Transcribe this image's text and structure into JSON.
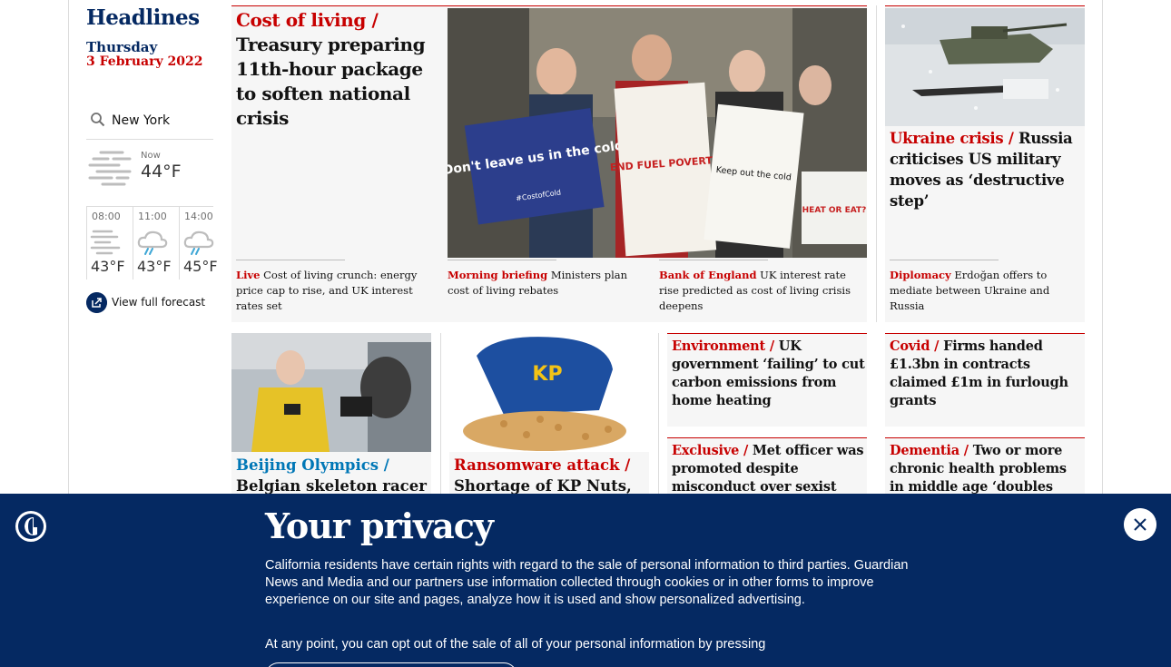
{
  "sidebar": {
    "title": "Headlines",
    "day": "Thursday",
    "date": "3 February 2022",
    "weather": {
      "city": "New York",
      "now_label": "Now",
      "now_temp": "44°F",
      "now_icon": "fog-icon",
      "hours": [
        {
          "time": "08:00",
          "temp": "43°F",
          "icon": "fog-icon"
        },
        {
          "time": "11:00",
          "temp": "43°F",
          "icon": "rain-cloud-icon"
        },
        {
          "time": "14:00",
          "temp": "45°F",
          "icon": "rain-cloud-icon"
        }
      ],
      "forecast_label": "View full forecast"
    }
  },
  "main_story": {
    "kicker": "Cost of living",
    "headline": "Treasury preparing 11th-hour package to soften national crisis",
    "image_signs": [
      "Don't leave us in the cold",
      "#CostofCold",
      "END FUEL POVERTY",
      "Keep out the cold",
      "HEAT OR EAT?"
    ],
    "subs": [
      {
        "kicker": "Live",
        "text": "Cost of living crunch: energy price cap to rise, and UK interest rates set"
      },
      {
        "kicker": "Morning briefing",
        "text": "Ministers plan cost of living rebates"
      },
      {
        "kicker": "Bank of England",
        "text": "UK interest rate rise predicted as cost of living crisis deepens"
      }
    ]
  },
  "ukraine_story": {
    "kicker": "Ukraine crisis",
    "headline": "Russia criticises US military moves as ‘destructive step’",
    "sub": {
      "kicker": "Diplomacy",
      "text": "Erdoğan offers to mediate between Ukraine and Russia"
    }
  },
  "beijing_story": {
    "kicker": "Beijing Olympics",
    "headline": "Belgian skeleton racer"
  },
  "ransomware_story": {
    "kicker": "Ransomware attack",
    "headline": "Shortage of KP Nuts,",
    "image_brand": "KP"
  },
  "small_stories": [
    {
      "kicker": "Environment",
      "headline": "UK government ‘failing’ to cut carbon emissions from home heating"
    },
    {
      "kicker": "Covid",
      "headline": "Firms handed £1.3bn in contracts claimed £1m in furlough grants"
    },
    {
      "kicker": "Exclusive",
      "headline": "Met officer was promoted despite misconduct over sexist and"
    },
    {
      "kicker": "Dementia",
      "headline": "Two or more chronic health problems in middle age ‘doubles risk’"
    }
  ],
  "privacy": {
    "title": "Your privacy",
    "body": "California residents have certain rights with regard to the sale of personal information to third parties. Guardian News and Media and our partners use information collected through cookies or in other forms to improve experience on our site and pages, analyze how it is used and show personalized advertising.",
    "body2": "At any point, you can opt out of the sale of all of your personal information by pressing",
    "close_icon": "close-icon",
    "logo": "guardian-logo"
  },
  "colors": {
    "brand_blue": "#052962",
    "news_red": "#c70000",
    "card_bg": "#f6f6f6"
  }
}
